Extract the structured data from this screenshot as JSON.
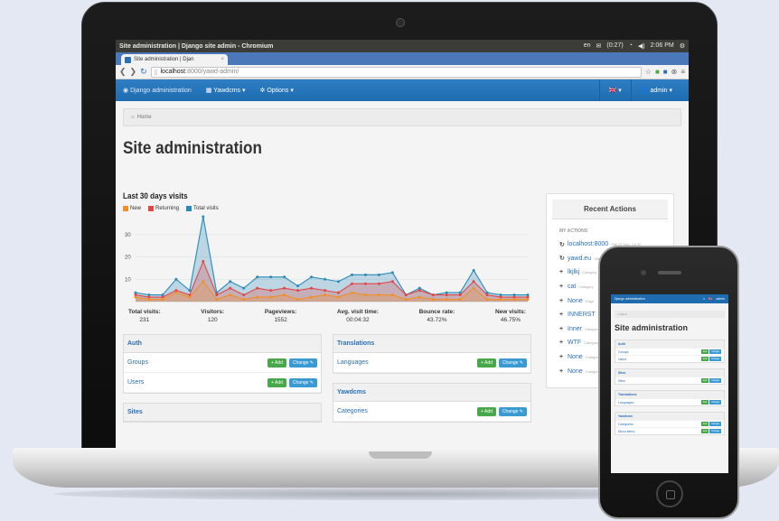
{
  "os": {
    "window_title": "Site administration | Django site admin - Chromium",
    "tray": [
      "en",
      "(0:27)",
      "2:06 PM"
    ]
  },
  "browser": {
    "tab_title": "Site administration | Djan",
    "url_host": "localhost",
    "url_path": ":8000/yawd-admin/"
  },
  "navbar": {
    "brand": "Django administration",
    "menu_yawdcms": "Yawdcms",
    "menu_options": "Options",
    "language": "🇬🇧",
    "user": "admin"
  },
  "breadcrumb": {
    "home": "Home"
  },
  "page_title": "Site administration",
  "chart_data": {
    "type": "line",
    "title": "Last 30 days visits",
    "yticks": [
      10,
      20,
      30
    ],
    "ylim": [
      0,
      38
    ],
    "series": [
      {
        "name": "New",
        "color": "#f0902a",
        "values": [
          2,
          1,
          1,
          4,
          2,
          9,
          1,
          3,
          1,
          2,
          2,
          3,
          1,
          2,
          3,
          2,
          4,
          3,
          3,
          3,
          1,
          2,
          1,
          1,
          1,
          6,
          1,
          1,
          1,
          1
        ]
      },
      {
        "name": "Returning",
        "color": "#e04848",
        "values": [
          3,
          2,
          2,
          5,
          3,
          18,
          3,
          6,
          3,
          6,
          5,
          6,
          5,
          6,
          5,
          4,
          8,
          8,
          8,
          9,
          3,
          5,
          3,
          3,
          3,
          9,
          3,
          2,
          2,
          2
        ]
      },
      {
        "name": "Total visits",
        "color": "#2a8ab8",
        "values": [
          4,
          3,
          3,
          10,
          5,
          38,
          4,
          9,
          6,
          11,
          11,
          11,
          7,
          11,
          10,
          9,
          12,
          12,
          12,
          13,
          3,
          6,
          3,
          4,
          4,
          14,
          4,
          3,
          3,
          3
        ]
      }
    ]
  },
  "stats": [
    {
      "label": "Total visits:",
      "value": "231"
    },
    {
      "label": "Visitors:",
      "value": "120"
    },
    {
      "label": "Pageviews:",
      "value": "1552"
    },
    {
      "label": "Avg. visit time:",
      "value": "00:04:32"
    },
    {
      "label": "Bounce rate:",
      "value": "43.72%"
    },
    {
      "label": "New visits:",
      "value": "46.75%"
    }
  ],
  "buttons": {
    "add": "Add",
    "change": "Change"
  },
  "apps_left": [
    {
      "name": "Auth",
      "models": [
        "Groups",
        "Users"
      ]
    },
    {
      "name": "Sites",
      "models": []
    }
  ],
  "apps_right": [
    {
      "name": "Translations",
      "models": [
        "Languages"
      ]
    },
    {
      "name": "Yawdcms",
      "models": [
        "Categories"
      ]
    }
  ],
  "recent_actions": {
    "title": "Recent Actions",
    "subtitle": "MY ACTIONS",
    "items": [
      {
        "symbol": "↻",
        "name": "localhost:8000",
        "meta": "Site 28 Nov, 14:39"
      },
      {
        "symbol": "↻",
        "name": "yawd.eu",
        "meta": "Site"
      },
      {
        "symbol": "+",
        "name": "lkjlkj",
        "meta": "Category"
      },
      {
        "symbol": "+",
        "name": "cat",
        "meta": "Category"
      },
      {
        "symbol": "+",
        "name": "None",
        "meta": "Page"
      },
      {
        "symbol": "+",
        "name": "INNERST",
        "meta": ""
      },
      {
        "symbol": "+",
        "name": "Inner",
        "meta": "Category"
      },
      {
        "symbol": "+",
        "name": "WTF",
        "meta": "Category"
      },
      {
        "symbol": "+",
        "name": "None",
        "meta": "Category"
      },
      {
        "symbol": "+",
        "name": "None",
        "meta": "Category"
      }
    ]
  },
  "phone": {
    "brand": "Django administration",
    "user": "admin",
    "home": "Home",
    "title": "Site administration",
    "add": "Add",
    "change": "Change",
    "apps": [
      {
        "name": "Auth",
        "models": [
          "Groups",
          "Users"
        ]
      },
      {
        "name": "Sites",
        "models": [
          "Sites"
        ]
      },
      {
        "name": "Translations",
        "models": [
          "Languages"
        ]
      },
      {
        "name": "Yawdcms",
        "models": [
          "Categories",
          "Menu items"
        ]
      }
    ]
  }
}
